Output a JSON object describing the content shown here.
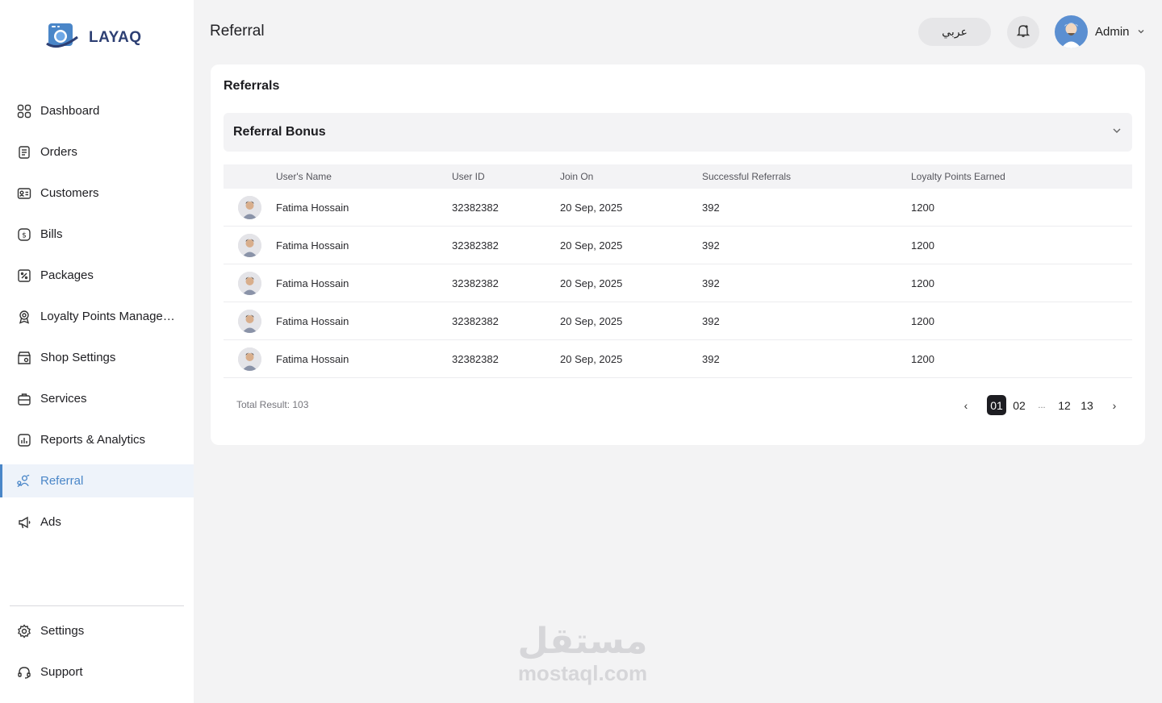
{
  "app": {
    "brand": "LAYAQ",
    "page_title": "Referral"
  },
  "sidebar": {
    "items": [
      {
        "label": "Dashboard",
        "icon": "dashboard-icon",
        "active": false
      },
      {
        "label": "Orders",
        "icon": "orders-icon",
        "active": false
      },
      {
        "label": "Customers",
        "icon": "customers-icon",
        "active": false
      },
      {
        "label": "Bills",
        "icon": "bills-icon",
        "active": false
      },
      {
        "label": "Packages",
        "icon": "packages-icon",
        "active": false
      },
      {
        "label": "Loyalty Points Management",
        "icon": "loyalty-icon",
        "active": false
      },
      {
        "label": "Shop Settings",
        "icon": "shop-icon",
        "active": false
      },
      {
        "label": "Services",
        "icon": "services-icon",
        "active": false
      },
      {
        "label": "Reports & Analytics",
        "icon": "reports-icon",
        "active": false
      },
      {
        "label": "Referral",
        "icon": "referral-icon",
        "active": true
      },
      {
        "label": "Ads",
        "icon": "megaphone-icon",
        "active": false
      }
    ],
    "bottom": [
      {
        "label": "Settings",
        "icon": "gear-icon"
      },
      {
        "label": "Support",
        "icon": "headset-icon"
      }
    ]
  },
  "header": {
    "language_label": "عربي",
    "user_name": "Admin"
  },
  "card": {
    "title": "Referrals",
    "accordion_title": "Referral Bonus",
    "columns": [
      "User's Name",
      "User ID",
      "Join On",
      "Successful Referrals",
      "Loyalty Points Earned"
    ],
    "rows": [
      {
        "name": "Fatima Hossain",
        "user_id": "32382382",
        "joined": "20 Sep, 2025",
        "referrals": "392",
        "points": "1200"
      },
      {
        "name": "Fatima Hossain",
        "user_id": "32382382",
        "joined": "20 Sep, 2025",
        "referrals": "392",
        "points": "1200"
      },
      {
        "name": "Fatima Hossain",
        "user_id": "32382382",
        "joined": "20 Sep, 2025",
        "referrals": "392",
        "points": "1200"
      },
      {
        "name": "Fatima Hossain",
        "user_id": "32382382",
        "joined": "20 Sep, 2025",
        "referrals": "392",
        "points": "1200"
      },
      {
        "name": "Fatima Hossain",
        "user_id": "32382382",
        "joined": "20 Sep, 2025",
        "referrals": "392",
        "points": "1200"
      }
    ],
    "total_result": "Total Result: 103",
    "pagination": {
      "prev": "‹",
      "pages": [
        "01",
        "02",
        "...",
        "12",
        "13"
      ],
      "active": "01",
      "next": "›"
    }
  },
  "watermark": {
    "arabic": "مستقل",
    "latin": "mostaql.com"
  },
  "colors": {
    "accent": "#4a86c8",
    "brand": "#2d3f73",
    "background": "#f3f3f4"
  }
}
